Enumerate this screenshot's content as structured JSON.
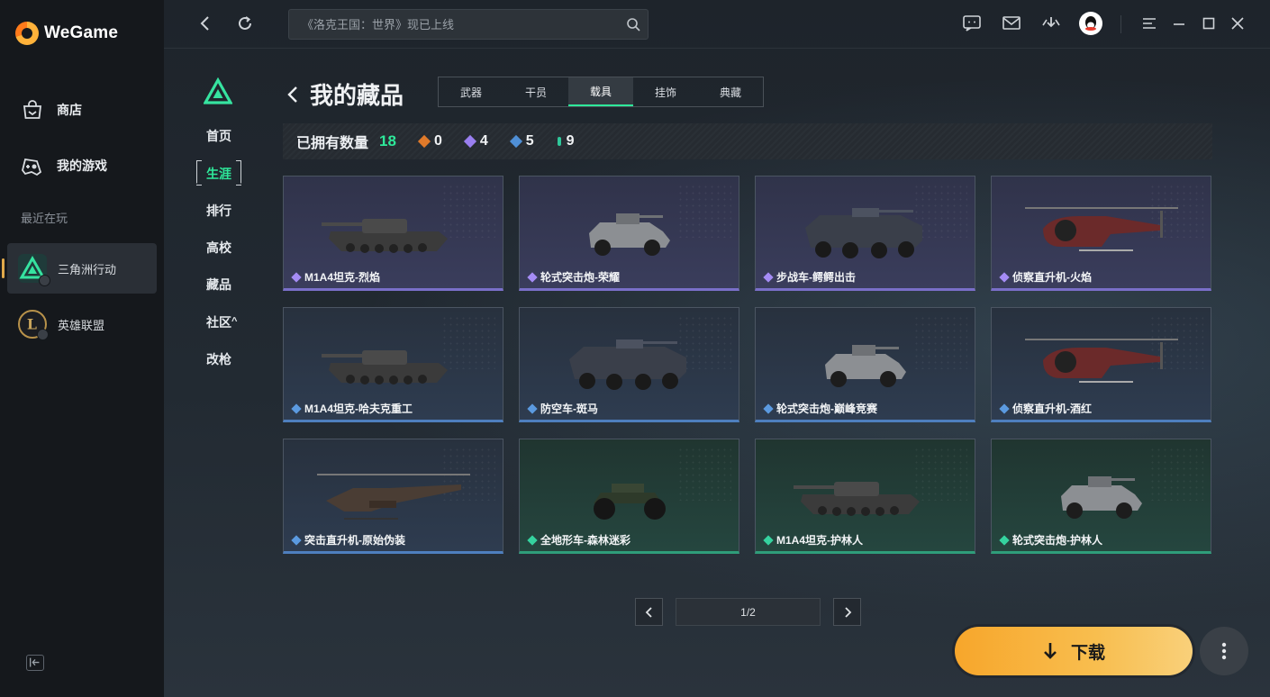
{
  "app": {
    "brand": "WeGame"
  },
  "sidebar": {
    "nav": [
      {
        "label": "商店",
        "icon": "shop-bag-icon"
      },
      {
        "label": "我的游戏",
        "icon": "gamepad-icon"
      }
    ],
    "recent_label": "最近在玩",
    "recent": [
      {
        "label": "三角洲行动",
        "icon": "delta-force-game-icon",
        "active": true
      },
      {
        "label": "英雄联盟",
        "icon": "league-of-legends-game-icon",
        "active": false
      }
    ]
  },
  "topbar": {
    "search_placeholder": "《洛克王国：世界》现已上线",
    "icons": [
      "back-icon",
      "refresh-icon",
      "search-icon",
      "chat-icon",
      "mail-icon",
      "download-manager-icon",
      "qq-avatar-icon",
      "menu-icon",
      "minimize-icon",
      "maximize-icon",
      "close-icon"
    ]
  },
  "subnav": {
    "items": [
      {
        "label": "首页",
        "active": false
      },
      {
        "label": "生涯",
        "active": true
      },
      {
        "label": "排行",
        "active": false
      },
      {
        "label": "高校",
        "active": false
      },
      {
        "label": "藏品",
        "active": false
      },
      {
        "label": "社区",
        "active": false,
        "suffix": "^"
      },
      {
        "label": "改枪",
        "active": false
      }
    ]
  },
  "page": {
    "title": "我的藏品",
    "tabs": [
      {
        "label": "武器",
        "active": false
      },
      {
        "label": "干员",
        "active": false
      },
      {
        "label": "载具",
        "active": true
      },
      {
        "label": "挂饰",
        "active": false
      },
      {
        "label": "典藏",
        "active": false
      }
    ],
    "summary": {
      "label": "已拥有数量",
      "total": "18",
      "rarities": [
        {
          "value": "0",
          "color": "#e07a2a"
        },
        {
          "value": "4",
          "color": "#9a7ff0"
        },
        {
          "value": "5",
          "color": "#4f8fd6"
        },
        {
          "value": "9",
          "color": "#2fc79a"
        }
      ]
    },
    "items": [
      {
        "name": "M1A4坦克-烈焰",
        "rarity": "purple",
        "kind": "tank",
        "gem": "#a58cf5"
      },
      {
        "name": "轮式突击炮-荣耀",
        "rarity": "purple",
        "kind": "armored-car",
        "gem": "#a58cf5"
      },
      {
        "name": "步战车-鳄鳄出击",
        "rarity": "purple",
        "kind": "ifv",
        "gem": "#a58cf5"
      },
      {
        "name": "侦察直升机-火焰",
        "rarity": "purple",
        "kind": "heli",
        "gem": "#a58cf5"
      },
      {
        "name": "M1A4坦克-哈夫克重工",
        "rarity": "blue",
        "kind": "tank",
        "gem": "#5b9ae0"
      },
      {
        "name": "防空车-斑马",
        "rarity": "blue",
        "kind": "ifv",
        "gem": "#5b9ae0"
      },
      {
        "name": "轮式突击炮-巅峰竞赛",
        "rarity": "blue",
        "kind": "armored-car",
        "gem": "#5b9ae0"
      },
      {
        "name": "侦察直升机-酒红",
        "rarity": "blue",
        "kind": "heli",
        "gem": "#5b9ae0"
      },
      {
        "name": "突击直升机-原始伪装",
        "rarity": "blue",
        "kind": "attack-heli",
        "gem": "#5b9ae0"
      },
      {
        "name": "全地形车-森林迷彩",
        "rarity": "green",
        "kind": "atv",
        "gem": "#35d39f"
      },
      {
        "name": "M1A4坦克-护林人",
        "rarity": "green",
        "kind": "tank",
        "gem": "#35d39f"
      },
      {
        "name": "轮式突击炮-护林人",
        "rarity": "green",
        "kind": "armored-car",
        "gem": "#35d39f"
      }
    ],
    "pager": {
      "text": "1/2"
    }
  },
  "download": {
    "label": "下载"
  }
}
